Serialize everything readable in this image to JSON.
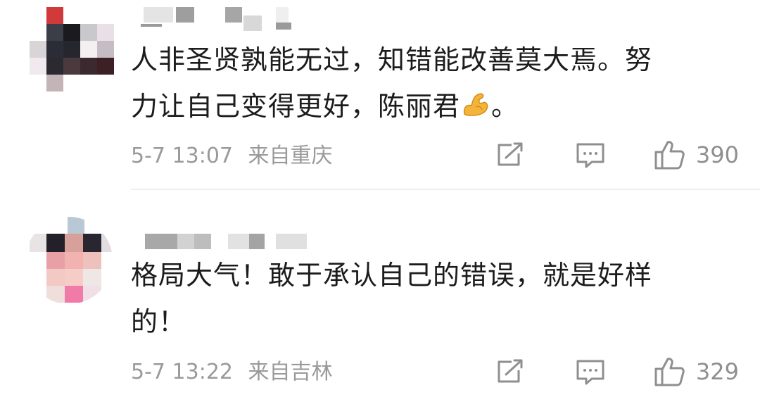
{
  "comments": [
    {
      "text_line1": "人非圣贤孰能无过，知错能改善莫大焉。努",
      "text_line2a": "力让自己变得更好，陈丽君",
      "text_line2b": "。",
      "emoji": "flexed-biceps",
      "time": "5-7 13:07",
      "location": "来自重庆",
      "likes": "390"
    },
    {
      "text_line1": "格局大气！敢于承认自己的错误，就是好样",
      "text_line2": "的！",
      "time": "5-7 13:22",
      "location": "来自吉林",
      "likes": "329"
    }
  ],
  "icons": {
    "share": "share-icon",
    "reply": "comment-icon",
    "like": "thumbs-up-icon"
  },
  "colors": {
    "text": "#1c1c1c",
    "meta": "#9a9a9a",
    "divider": "#eeeeee"
  }
}
